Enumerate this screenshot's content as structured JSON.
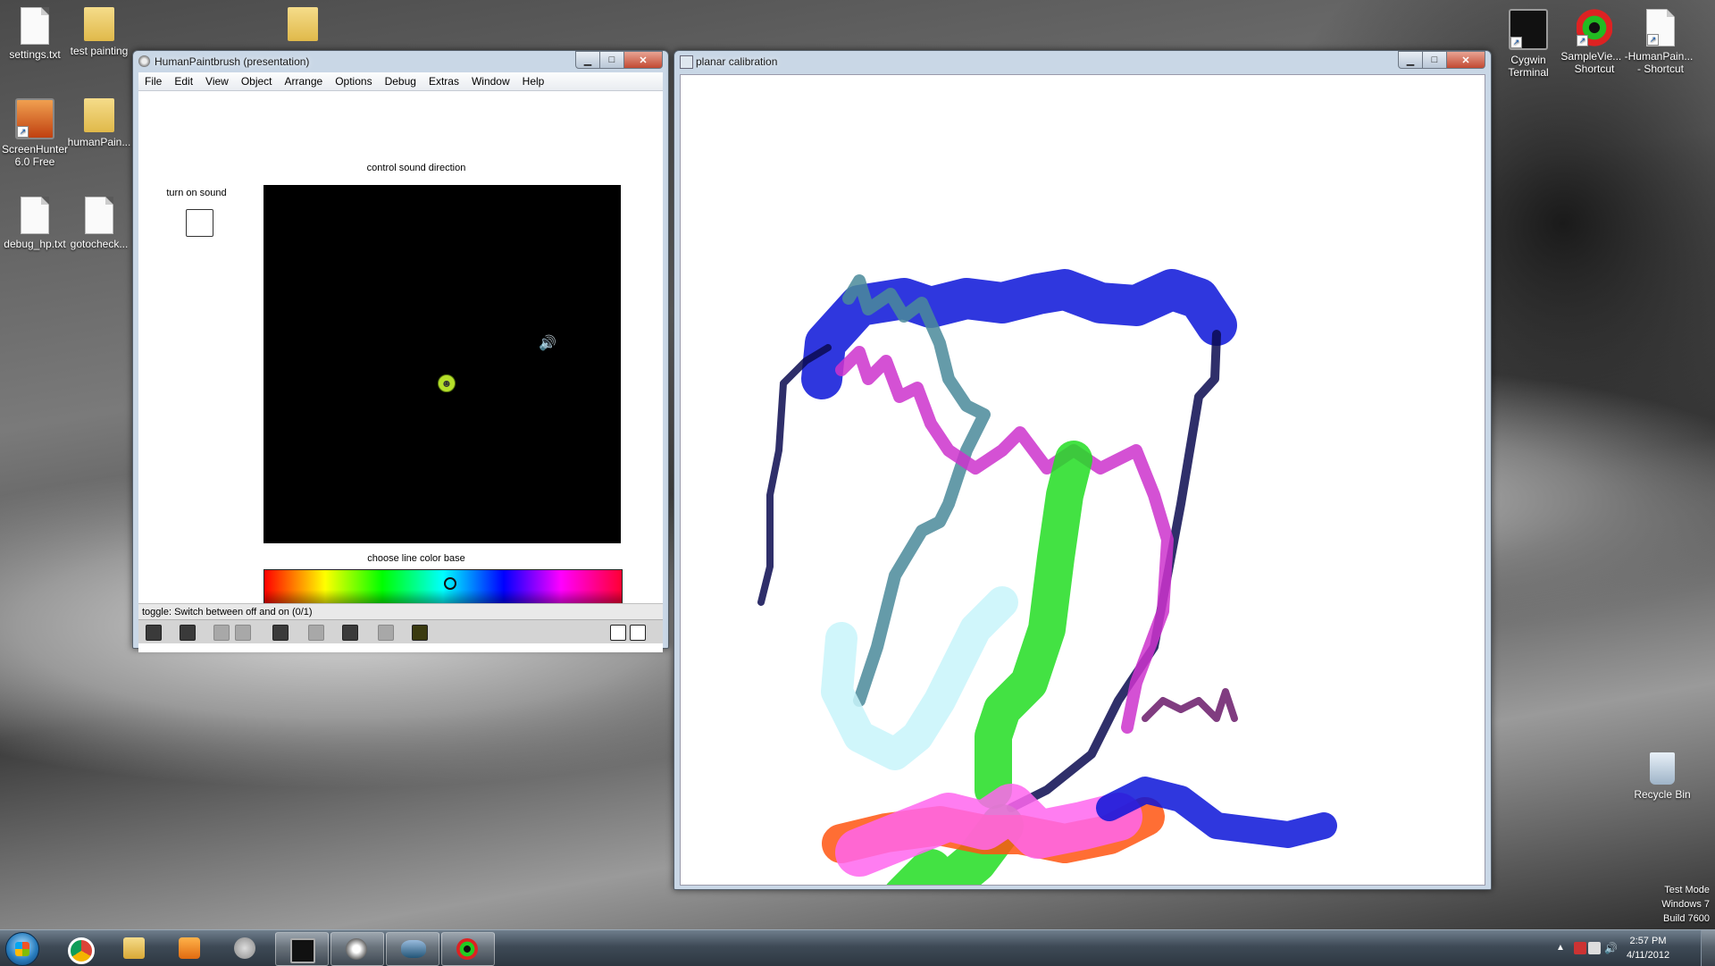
{
  "desktop": {
    "icons": [
      {
        "label": "settings.txt"
      },
      {
        "label": "test painting"
      },
      {
        "label": ""
      },
      {
        "label": "ScreenHunter 6.0 Free"
      },
      {
        "label": "humanPain..."
      },
      {
        "label": "debug_hp.txt"
      },
      {
        "label": "gotocheck..."
      },
      {
        "label": "Cygwin Terminal"
      },
      {
        "label": "SampleVie... - Shortcut"
      },
      {
        "label": "HumanPain... - Shortcut"
      },
      {
        "label": "Recycle Bin"
      }
    ],
    "watermark": {
      "line1": "Test Mode",
      "line2": "Windows 7",
      "line3": "Build 7600"
    }
  },
  "paint_window": {
    "title": "HumanPaintbrush (presentation)",
    "menu": [
      "File",
      "Edit",
      "View",
      "Object",
      "Arrange",
      "Options",
      "Debug",
      "Extras",
      "Window",
      "Help"
    ],
    "sound_label": "turn on sound",
    "sound_checked": false,
    "direction_label": "control sound direction",
    "color_label": "choose line color base",
    "status": "toggle: Switch between off and on (0/1)",
    "tool_icons": [
      "lock-icon",
      "layers-icon",
      "group-icon",
      "delete-icon",
      "image-icon",
      "info-icon",
      "slider-icon",
      "grid-icon",
      "palette-icon",
      "single-view-icon",
      "split-view-icon"
    ]
  },
  "calib_window": {
    "title": "planar calibration"
  },
  "taskbar": {
    "pinned": [
      "start-button",
      "chrome-icon",
      "explorer-icon",
      "media-player-icon",
      "itunes-icon",
      "cygwin-icon",
      "humanpaintbrush-icon",
      "opengl-icon",
      "sampleviewer-icon"
    ],
    "clock_time": "2:57 PM",
    "clock_date": "4/11/2012"
  },
  "colors": {
    "stroke_blue": "#0a14d8",
    "stroke_teal": "#4a8a9a",
    "stroke_magenta": "#cc33cc",
    "stroke_green": "#22dd22",
    "stroke_cyan_light": "#c8f4fa",
    "stroke_orange": "#ff5511",
    "stroke_pink": "#ff66ee",
    "stroke_navy": "#0a0a50",
    "stroke_purple": "#6a1a6a"
  }
}
